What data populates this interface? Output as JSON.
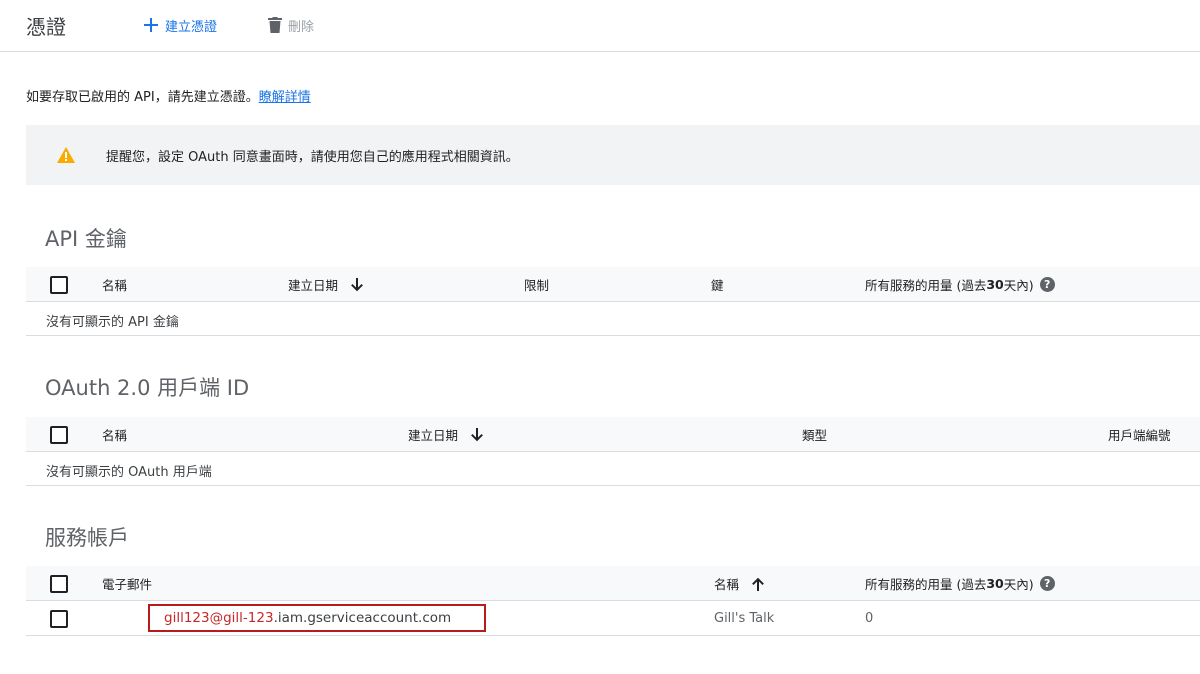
{
  "toolbar": {
    "title": "憑證",
    "create_label": "建立憑證",
    "delete_label": "刪除"
  },
  "intro": {
    "text": "如要存取已啟用的 API，請先建立憑證。",
    "link": "瞭解詳情"
  },
  "notice": {
    "text": "提醒您，設定 OAuth 同意畫面時，請使用您自己的應用程式相關資訊。"
  },
  "api_keys": {
    "title": "API 金鑰",
    "columns": {
      "name": "名稱",
      "created": "建立日期",
      "restrictions": "限制",
      "key": "鍵",
      "usage_prefix": "所有服務的用量 (過去 ",
      "usage_bold": "30",
      "usage_suffix": " 天內)"
    },
    "empty": "沒有可顯示的 API 金鑰"
  },
  "oauth": {
    "title": "OAuth 2.0 用戶端 ID",
    "columns": {
      "name": "名稱",
      "created": "建立日期",
      "type": "類型",
      "client_id": "用戶端編號"
    },
    "empty": "沒有可顯示的 OAuth 用戶端"
  },
  "service_accounts": {
    "title": "服務帳戶",
    "columns": {
      "email": "電子郵件",
      "name": "名稱",
      "usage_prefix": "所有服務的用量 (過去 ",
      "usage_bold": "30",
      "usage_suffix": " 天內)"
    },
    "rows": [
      {
        "email_user": "gill123@gill-123",
        "email_domain": " .iam.gserviceaccount.com",
        "name": "Gill's Talk",
        "usage": "0"
      }
    ]
  },
  "icons": {
    "create": "plus-icon",
    "delete": "trash-icon",
    "warning": "warning-icon",
    "help": "help-icon",
    "sort_down": "arrow-down-icon",
    "sort_up": "arrow-up-icon"
  },
  "colors": {
    "link": "#1a73e8",
    "warning": "#f9ab00",
    "highlight_border": "#b71c1c",
    "highlight_text": "#c62828"
  }
}
